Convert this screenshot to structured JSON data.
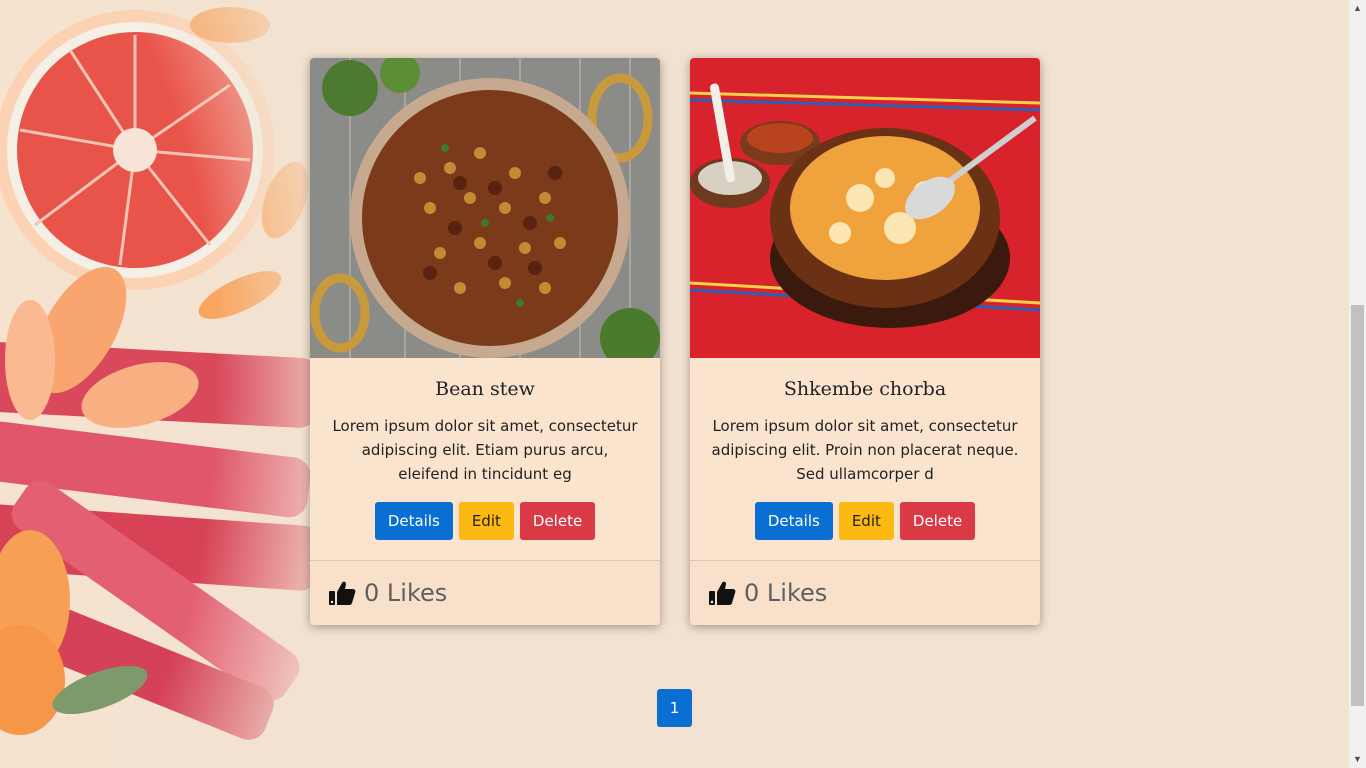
{
  "recipes": [
    {
      "title": "Bean stew",
      "description": "Lorem ipsum dolor sit amet, consectetur adipiscing elit. Etiam purus arcu, eleifend in tincidunt eg",
      "details_label": "Details",
      "edit_label": "Edit",
      "delete_label": "Delete",
      "likes_label": "0 Likes",
      "image_icon": "bean-stew-photo"
    },
    {
      "title": "Shkembe chorba",
      "description": "Lorem ipsum dolor sit amet, consectetur adipiscing elit. Proin non placerat neque. Sed ullamcorper d",
      "details_label": "Details",
      "edit_label": "Edit",
      "delete_label": "Delete",
      "likes_label": "0 Likes",
      "image_icon": "shkembe-chorba-photo"
    }
  ],
  "pagination": {
    "current_page": "1"
  },
  "icons": {
    "like": "thumbs-up-icon",
    "scroll_up": "▲",
    "scroll_down": "▼"
  },
  "colors": {
    "page_background": "#f2e3d3",
    "card_background": "#fbe4ce",
    "details_button": "#0a6fd3",
    "edit_button": "#fbb911",
    "delete_button": "#da3a46",
    "pagination_active": "#0a6fd3"
  }
}
